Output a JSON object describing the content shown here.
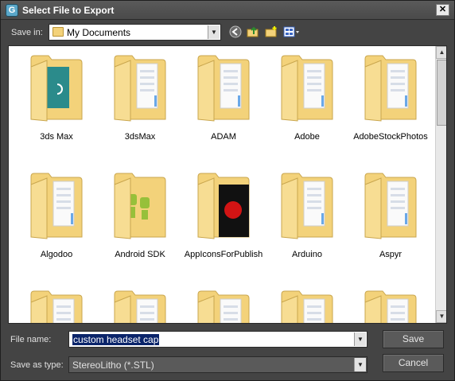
{
  "window": {
    "title": "Select File to Export",
    "app_icon_letter": "G",
    "close_glyph": "✕"
  },
  "toolbar": {
    "save_in_label": "Save in:",
    "save_in_value": "My Documents",
    "tools": [
      "back-icon",
      "up-folder-icon",
      "new-folder-icon",
      "view-menu-icon"
    ]
  },
  "files": [
    {
      "label": "3ds Max",
      "preview": "teal"
    },
    {
      "label": "3dsMax",
      "preview": "docs"
    },
    {
      "label": "ADAM",
      "preview": "docs"
    },
    {
      "label": "Adobe",
      "preview": "docs"
    },
    {
      "label": "AdobeStockPhotos",
      "preview": "docs"
    },
    {
      "label": "Algodoo",
      "preview": "docs"
    },
    {
      "label": "Android SDK",
      "preview": "android"
    },
    {
      "label": "AppIconsForPublish",
      "preview": "dark"
    },
    {
      "label": "Arduino",
      "preview": "docs"
    },
    {
      "label": "Aspyr",
      "preview": "docs"
    },
    {
      "label": "",
      "preview": "docs"
    },
    {
      "label": "",
      "preview": "docs"
    },
    {
      "label": "",
      "preview": "docs"
    },
    {
      "label": "",
      "preview": "docs"
    },
    {
      "label": "",
      "preview": "docs"
    }
  ],
  "form": {
    "file_name_label": "File name:",
    "file_name_value": "custom headset cap",
    "save_as_type_label": "Save as type:",
    "save_as_type_value": "StereoLitho (*.STL)",
    "save_label": "Save",
    "cancel_label": "Cancel"
  },
  "colors": {
    "folder": "#f3d27a",
    "selection": "#0a246a",
    "dialog_bg": "#444444"
  }
}
